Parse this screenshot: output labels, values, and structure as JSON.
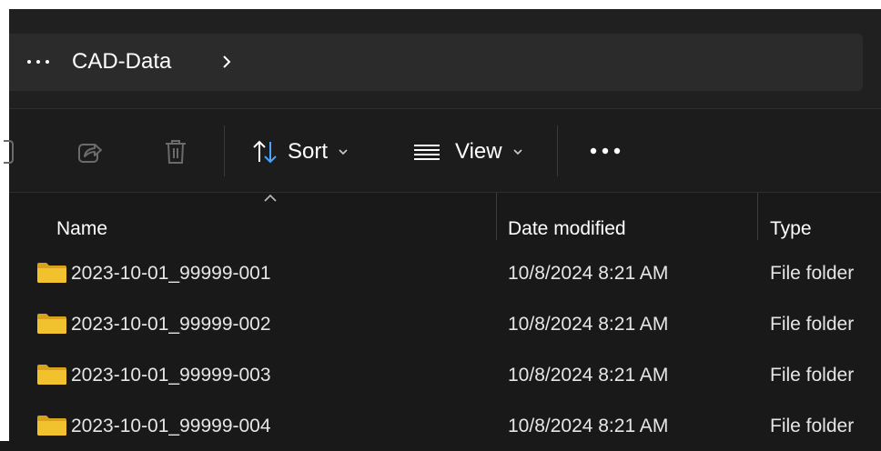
{
  "address": {
    "overflow_label": "···",
    "breadcrumb": "CAD-Data",
    "chevron_icon": "chevron-right-icon"
  },
  "toolbar": {
    "share_icon": "share-icon",
    "delete_icon": "trash-icon",
    "sort_label": "Sort",
    "view_label": "View",
    "more_label": "•••"
  },
  "columns": {
    "name": "Name",
    "date": "Date modified",
    "type": "Type"
  },
  "rows": [
    {
      "name": "2023-10-01_99999-001",
      "date": "10/8/2024 8:21 AM",
      "type": "File folder"
    },
    {
      "name": "2023-10-01_99999-002",
      "date": "10/8/2024 8:21 AM",
      "type": "File folder"
    },
    {
      "name": "2023-10-01_99999-003",
      "date": "10/8/2024 8:21 AM",
      "type": "File folder"
    },
    {
      "name": "2023-10-01_99999-004",
      "date": "10/8/2024 8:21 AM",
      "type": "File folder"
    }
  ],
  "colors": {
    "folder": "#f2c12e",
    "background": "#191919",
    "address_bar": "#2b2b2b"
  }
}
